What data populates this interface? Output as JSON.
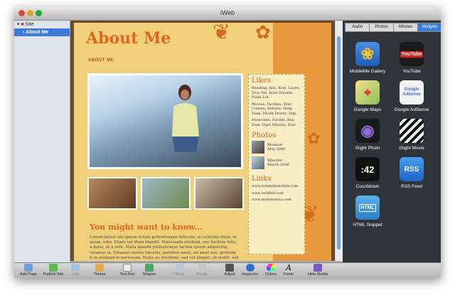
{
  "window": {
    "title": "iWeb"
  },
  "sidebar": {
    "items": [
      {
        "label": "Site"
      },
      {
        "label": "About Me",
        "selected": true
      }
    ]
  },
  "page": {
    "title": "About Me",
    "subtitle": "ABOUT ME",
    "likes": {
      "heading": "Likes",
      "reading": "Reading: Alio, Erat, Laore, Eros Vel, Rure Dolorer, Niam Lut.",
      "movies": "Movies: Facillan, Vent Consen, Dolorer, Feng Tiam, Modit Prarer, Tem.",
      "musicians": "Musicians: Facinis, Rea Eum, Dipit Minisip, Enil."
    },
    "photos": {
      "heading": "Photos",
      "items": [
        {
          "title": "Reunion",
          "date": "May 2006"
        },
        {
          "title": "Whistler",
          "date": "March 2006"
        }
      ]
    },
    "links": {
      "heading": "Links",
      "items": [
        "www.loremimsiudate.com",
        "www.estlibet.com",
        "www.moreaumva.com"
      ]
    },
    "section_heading": "You might want to know...",
    "body_text": "Consectetuer atu ipsum ectum pellentesque vehicula, in vehicula diam, in quam, odio. Etiam vel diam blandit. Malesuada eleifend, nec facilisis felis, a dolor, ut a velit. Nulla blandit pellentesque lacinia ipsum adipiscing, vivamus in. Vivamus mattis lobortis, porttitor amet, sit amet nec, pretium it in eleifend in nervosum. Nulla eu tincidunt, sed vel aliquet, ut mollit, sed molestie."
  },
  "right_panel": {
    "tabs": [
      {
        "label": "Audio"
      },
      {
        "label": "Photos"
      },
      {
        "label": "Movies"
      },
      {
        "label": "Widgets",
        "active": true
      }
    ],
    "widgets": [
      {
        "label": "MobileMe Gallery",
        "icon": "sunflower-icon"
      },
      {
        "label": "YouTube",
        "icon": "youtube-icon",
        "glyph": "YouTube"
      },
      {
        "label": "Google Maps",
        "icon": "google-maps-icon"
      },
      {
        "label": "Google AdSense",
        "icon": "google-adsense-icon",
        "glyph": "Google AdSense"
      },
      {
        "label": "iSight Photo",
        "icon": "isight-icon"
      },
      {
        "label": "iSight Movie",
        "icon": "clapperboard-icon"
      },
      {
        "label": "Countdown",
        "icon": "countdown-icon",
        "glyph": ":42"
      },
      {
        "label": "RSS Feed",
        "icon": "rss-icon",
        "glyph": "RSS"
      },
      {
        "label": "HTML Snippet",
        "icon": "html-icon",
        "glyph": "HTML"
      }
    ]
  },
  "toolbar": {
    "items": [
      {
        "label": "Add Page"
      },
      {
        "label": "Publish Site"
      },
      {
        "label": "Visit"
      },
      {
        "label": "Theme"
      },
      {
        "label": "Text Box"
      },
      {
        "label": "Shapes"
      },
      {
        "label": "Mask"
      },
      {
        "label": "Rotate"
      },
      {
        "label": "Adjust"
      },
      {
        "label": "Inspector"
      },
      {
        "label": "Colors"
      },
      {
        "label": "Fonts"
      },
      {
        "label": "Hide Media"
      }
    ]
  }
}
